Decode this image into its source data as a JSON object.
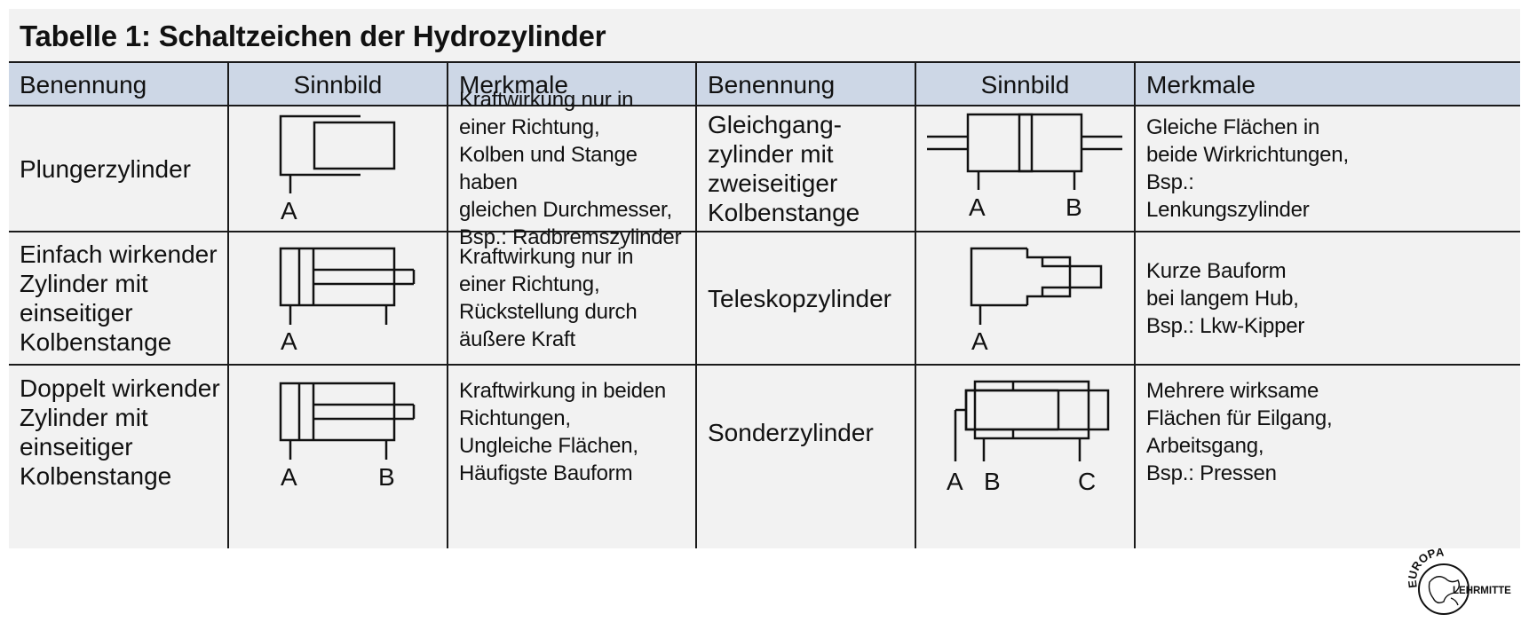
{
  "title": "Tabelle 1:  Schaltzeichen der Hydrozylinder",
  "headers": [
    "Benennung",
    "Sinnbild",
    "Merkmale",
    "Benennung",
    "Sinnbild",
    "Merkmale"
  ],
  "rows": [
    {
      "left": {
        "name": "Plungerzylinder",
        "features": "Kraftwirkung nur in\neiner Richtung,\nKolben und Stange haben\ngleichen Durchmesser,\nBsp.: Radbremszylinder",
        "ports": [
          "A"
        ]
      },
      "right": {
        "name": "Gleichgang-\nzylinder mit\nzweiseitiger\nKolbenstange",
        "features": "Gleiche Flächen in\nbeide Wirkrichtungen,\nBsp.:\nLenkungszylinder",
        "ports": [
          "A",
          "B"
        ]
      }
    },
    {
      "left": {
        "name": "Einfach wirkender\nZylinder mit\neinseitiger\nKolbenstange",
        "features": "Kraftwirkung nur in\neiner Richtung,\nRückstellung durch\näußere Kraft",
        "ports": [
          "A"
        ]
      },
      "right": {
        "name": "Teleskopzylinder",
        "features": "Kurze Bauform\nbei langem Hub,\nBsp.: Lkw-Kipper",
        "ports": [
          "A"
        ]
      }
    },
    {
      "left": {
        "name": "Doppelt wirkender\nZylinder mit\neinseitiger\nKolbenstange",
        "features": "Kraftwirkung in beiden\nRichtungen,\nUngleiche Flächen,\nHäufigste Bauform",
        "ports": [
          "A",
          "B"
        ]
      },
      "right": {
        "name": "Sonderzylinder",
        "features": "Mehrere wirksame\nFlächen für Eilgang,\nArbeitsgang,\nBsp.: Pressen",
        "ports": [
          "A",
          "B",
          "C"
        ]
      }
    }
  ],
  "logo": {
    "top_text": "EUROPA",
    "bottom_text": "LEHRMITTEL"
  }
}
